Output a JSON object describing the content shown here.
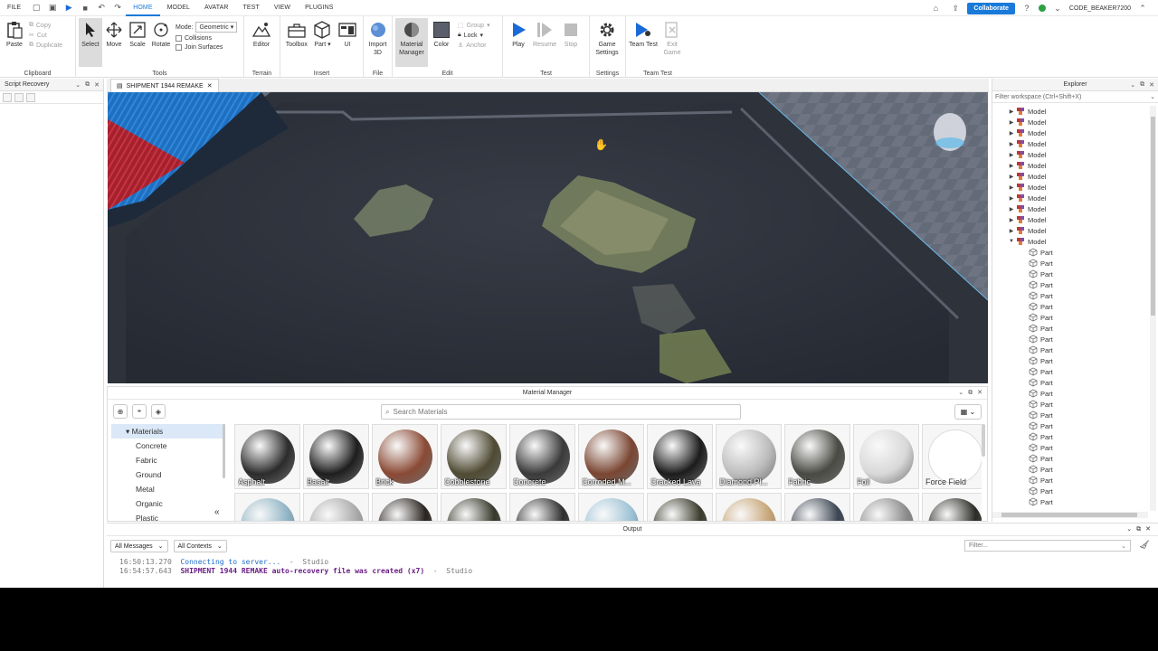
{
  "menu": {
    "file": "FILE",
    "tabs": [
      {
        "label": "HOME",
        "active": true
      },
      {
        "label": "MODEL",
        "active": false
      },
      {
        "label": "AVATAR",
        "active": false
      },
      {
        "label": "TEST",
        "active": false
      },
      {
        "label": "VIEW",
        "active": false
      },
      {
        "label": "PLUGINS",
        "active": false
      }
    ],
    "collaborate": "Collaborate",
    "username": "CODE_BEAKER7200"
  },
  "ribbon": {
    "clipboard": {
      "label": "Clipboard",
      "paste": "Paste",
      "copy": "Copy",
      "cut": "Cut",
      "duplicate": "Duplicate"
    },
    "tools": {
      "label": "Tools",
      "select": "Select",
      "move": "Move",
      "scale": "Scale",
      "rotate": "Rotate",
      "mode_label": "Mode:",
      "mode_value": "Geometric",
      "collisions": "Collisions",
      "join_surfaces": "Join Surfaces"
    },
    "terrain": {
      "label": "Terrain",
      "editor": "Editor"
    },
    "insert": {
      "label": "Insert",
      "toolbox": "Toolbox",
      "part": "Part",
      "ui": "UI"
    },
    "file": {
      "label": "File",
      "import3d": "Import 3D"
    },
    "edit": {
      "label": "Edit",
      "material_manager": "Material Manager",
      "color": "Color",
      "group": "Group",
      "lock": "Lock",
      "anchor": "Anchor"
    },
    "test": {
      "label": "Test",
      "play": "Play",
      "resume": "Resume",
      "stop": "Stop"
    },
    "settings": {
      "label": "Settings",
      "game_settings": "Game Settings"
    },
    "team_test": {
      "label": "Team Test",
      "team_test": "Team Test",
      "exit_game": "Exit Game"
    }
  },
  "left_panel": {
    "title": "Script Recovery"
  },
  "document_tab": {
    "title": "SHIPMENT 1944 REMAKE"
  },
  "material_manager": {
    "title": "Material Manager",
    "search_placeholder": "Search Materials",
    "tree_root": "Materials",
    "tree_items": [
      "Concrete",
      "Fabric",
      "Ground",
      "Metal",
      "Organic",
      "Plastic"
    ],
    "materials": [
      {
        "name": "Asphalt",
        "color": "#2c2c2c"
      },
      {
        "name": "Basalt",
        "color": "#1e1e1e"
      },
      {
        "name": "Brick",
        "color": "#8a4a35"
      },
      {
        "name": "Cobblestone",
        "color": "#4e4a33"
      },
      {
        "name": "Concrete",
        "color": "#3a3a3a"
      },
      {
        "name": "Corroded M...",
        "color": "#7a4632"
      },
      {
        "name": "Cracked Lava",
        "color": "#1c1c1c"
      },
      {
        "name": "Diamond Pl...",
        "color": "#bdbdbd"
      },
      {
        "name": "Fabric",
        "color": "#4a4a44"
      },
      {
        "name": "Foil",
        "color": "#d8d8d8"
      },
      {
        "name": "Force Field",
        "color": "#ffffff"
      }
    ],
    "second_row_colors": [
      "#8fb3c4",
      "#a9a9a9",
      "#2a2420",
      "#35382a",
      "#2e2e2e",
      "#9cc2d6",
      "#3a3a2c",
      "#c7a577",
      "#3b4552",
      "#8a8a8a",
      "#2b2b26"
    ]
  },
  "output": {
    "title": "Output",
    "messages_filter": "All Messages",
    "contexts_filter": "All Contexts",
    "filter_placeholder": "Filter...",
    "lines": [
      {
        "time": "16:50:13.270",
        "message": "Connecting to server...",
        "source": "Studio"
      },
      {
        "time": "16:54:57.643",
        "message": "SHIPMENT 1944 REMAKE auto-recovery file was created (x7)",
        "source": "Studio"
      }
    ]
  },
  "explorer": {
    "title": "Explorer",
    "filter_placeholder": "Filter workspace (Ctrl+Shift+X)",
    "models": [
      "Model",
      "Model",
      "Model",
      "Model",
      "Model",
      "Model",
      "Model",
      "Model",
      "Model",
      "Model",
      "Model",
      "Model",
      "Model"
    ],
    "parts": [
      "Part",
      "Part",
      "Part",
      "Part",
      "Part",
      "Part",
      "Part",
      "Part",
      "Part",
      "Part",
      "Part",
      "Part",
      "Part",
      "Part",
      "Part",
      "Part",
      "Part",
      "Part",
      "Part",
      "Part",
      "Part",
      "Part",
      "Part",
      "Part"
    ]
  }
}
